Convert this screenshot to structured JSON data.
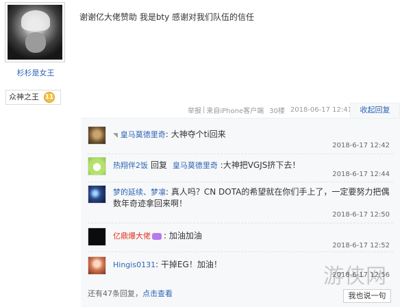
{
  "author": {
    "username": "杉杉是女王",
    "badge_text": "众神之王",
    "badge_level": "11"
  },
  "post": {
    "content": "谢谢亿大佬赞助 我是bty 感谢对我们队伍的信任"
  },
  "post_tail": {
    "report": "举报",
    "sep1": "|",
    "source": "来自iPhone客户端",
    "floor": "30楼",
    "time": "2018-06-17 12:41",
    "collapse_label": "收起回复"
  },
  "replies": [
    {
      "name": "皇马莫德里奇",
      "prefix": "",
      "text": ": 大神夺个ti回来",
      "time": "2018-6-17 12:42"
    },
    {
      "name": "热翔伴2饭",
      "prefix": "回复",
      "target": "皇马莫德里奇",
      "text": " :大神把VGJS挤下去！",
      "time": "2018-6-17 12:44"
    },
    {
      "name": "梦的延续、梦凛",
      "prefix": "",
      "text": ": 真人吗？CN DOTA的希望就在你们手上了，一定要努力把偶数年奇迹拿回来啊！",
      "time": "2018-6-17 12:50"
    },
    {
      "name": "亿鼎爆大佬",
      "prefix": "",
      "text": ": 加油加油",
      "time": "2018-6-17 12:52"
    },
    {
      "name": "Hingis0131",
      "prefix": "",
      "text": ": 干掉EG！加油！",
      "time": "2018-6-17 12:56"
    }
  ],
  "more": {
    "prefix": "还有47条回复，",
    "link": "点击查看"
  },
  "say_button": "我也说一句",
  "watermark": "游侠网"
}
